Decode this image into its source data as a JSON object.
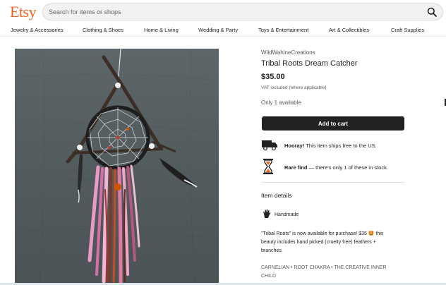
{
  "header": {
    "logo": "Etsy",
    "search_placeholder": "Search for items or shops"
  },
  "categories": [
    "Jewelry & Accessories",
    "Clothing & Shoes",
    "Home & Living",
    "Wedding & Party",
    "Toys & Entertainment",
    "Art & Collectibles",
    "Craft Supplies"
  ],
  "listing": {
    "shop_name": "WildWahineCreations",
    "title": "Tribal Roots Dream Catcher",
    "price": "$35.00",
    "vat_note": "VAT included (where applicable)",
    "stock": "Only 1 available",
    "add_to_cart": "Add to cart",
    "shipping": {
      "bold": "Hooray!",
      "text": " This item ships free to the US."
    },
    "rare": {
      "bold": "Rare find",
      "text": " — there's only 1 of these in stock."
    },
    "item_details_heading": "Item details",
    "handmade": "Handmade",
    "description_line1": "“Tribal Roots” is now available for purchase! $35 🤩 this",
    "description_line2": "beauty includes hand picked (cruelty free) feathers +",
    "description_line3": "branches.",
    "dot": ".",
    "tags_line1": "CARNELIAN • ROOT CHAKRA • THE CREATIVE INNER",
    "tags_line2": "CHILD"
  },
  "colors": {
    "brand": "#f1641e",
    "button": "#222222"
  },
  "icons": [
    "search-icon",
    "truck-icon",
    "hourglass-icon",
    "hand-icon"
  ]
}
